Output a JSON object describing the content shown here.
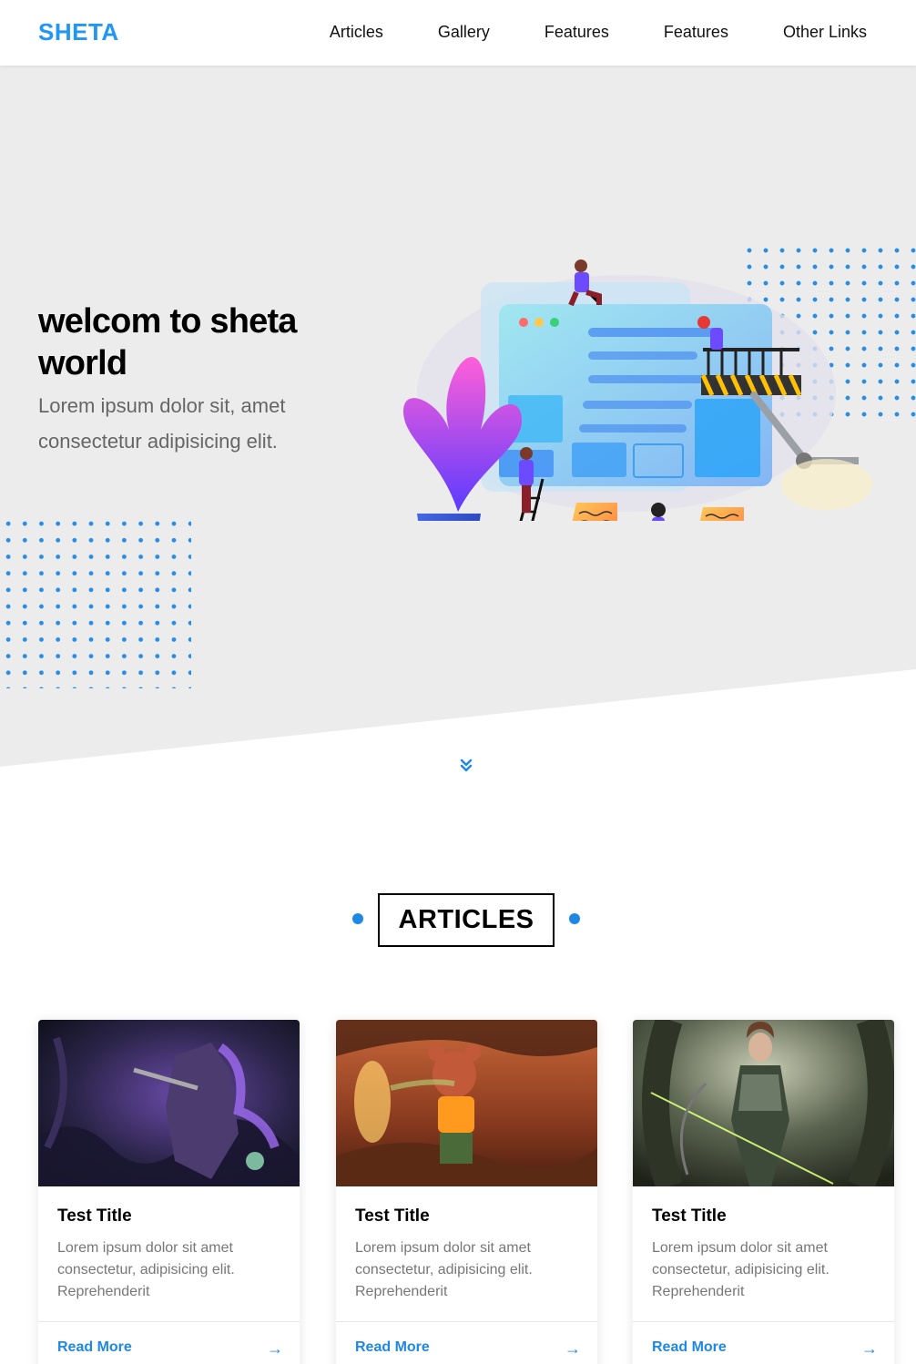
{
  "brand": {
    "logo": "SHETA"
  },
  "nav": {
    "items": [
      {
        "label": "Articles"
      },
      {
        "label": "Gallery"
      },
      {
        "label": "Features"
      },
      {
        "label": "Features"
      },
      {
        "label": "Other Links"
      }
    ]
  },
  "hero": {
    "title": "welcom to sheta world",
    "text": "Lorem ipsum dolor sit, amet consectetur adipisicing elit."
  },
  "scroll": {
    "icon": "double-chevron-down-icon"
  },
  "articles": {
    "section_title": "ARTICLES",
    "cards": [
      {
        "title": "Test Title",
        "text": "Lorem ipsum dolor sit amet consectetur, adipisicing elit. Reprehenderit",
        "link": "Read More",
        "arrow": "→",
        "image": "dark-fantasy-warrior-image"
      },
      {
        "title": "Test Title",
        "text": "Lorem ipsum dolor sit amet consectetur, adipisicing elit. Reprehenderit",
        "link": "Read More",
        "arrow": "→",
        "image": "cartoon-bear-character-image"
      },
      {
        "title": "Test Title",
        "text": "Lorem ipsum dolor sit amet consectetur, adipisicing elit. Reprehenderit",
        "link": "Read More",
        "arrow": "→",
        "image": "elf-archer-image"
      }
    ]
  },
  "colors": {
    "accent": "#1e88e5",
    "hero_bg": "#ececec"
  }
}
